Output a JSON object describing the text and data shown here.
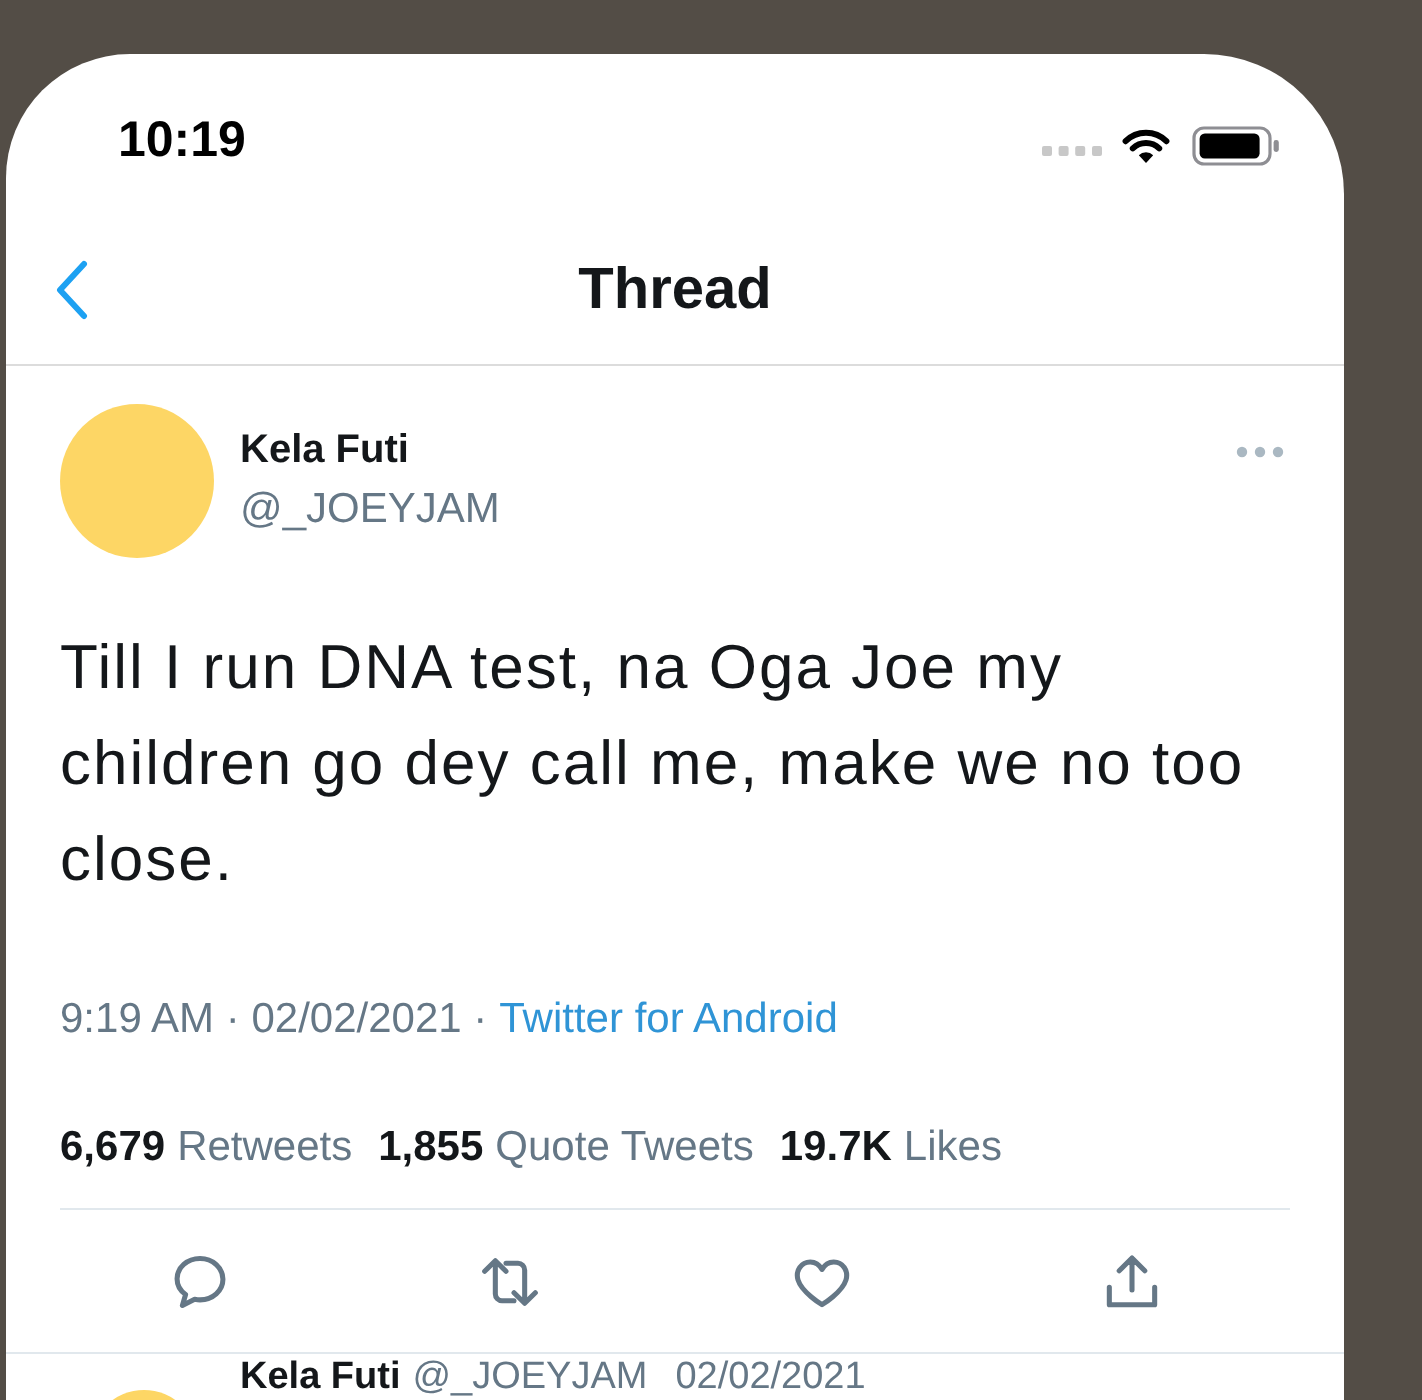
{
  "status_bar": {
    "time": "10:19"
  },
  "nav": {
    "title": "Thread"
  },
  "tweet": {
    "author": {
      "name": "Kela Futi",
      "handle": "@_JOEYJAM"
    },
    "text": "Till I run DNA test, na Oga Joe my children go dey call me, make we no too close.",
    "timestamp": "9:19 AM · 02/02/2021 ·",
    "source": "Twitter for Android",
    "stats": [
      {
        "count": "6,679",
        "label": "Retweets"
      },
      {
        "count": "1,855",
        "label": "Quote Tweets"
      },
      {
        "count": "19.7K",
        "label": "Likes"
      }
    ]
  },
  "replies": [
    {
      "name": "Kela Futi",
      "handle": "@_JOEYJAM",
      "date": "02/02/2021"
    }
  ]
}
